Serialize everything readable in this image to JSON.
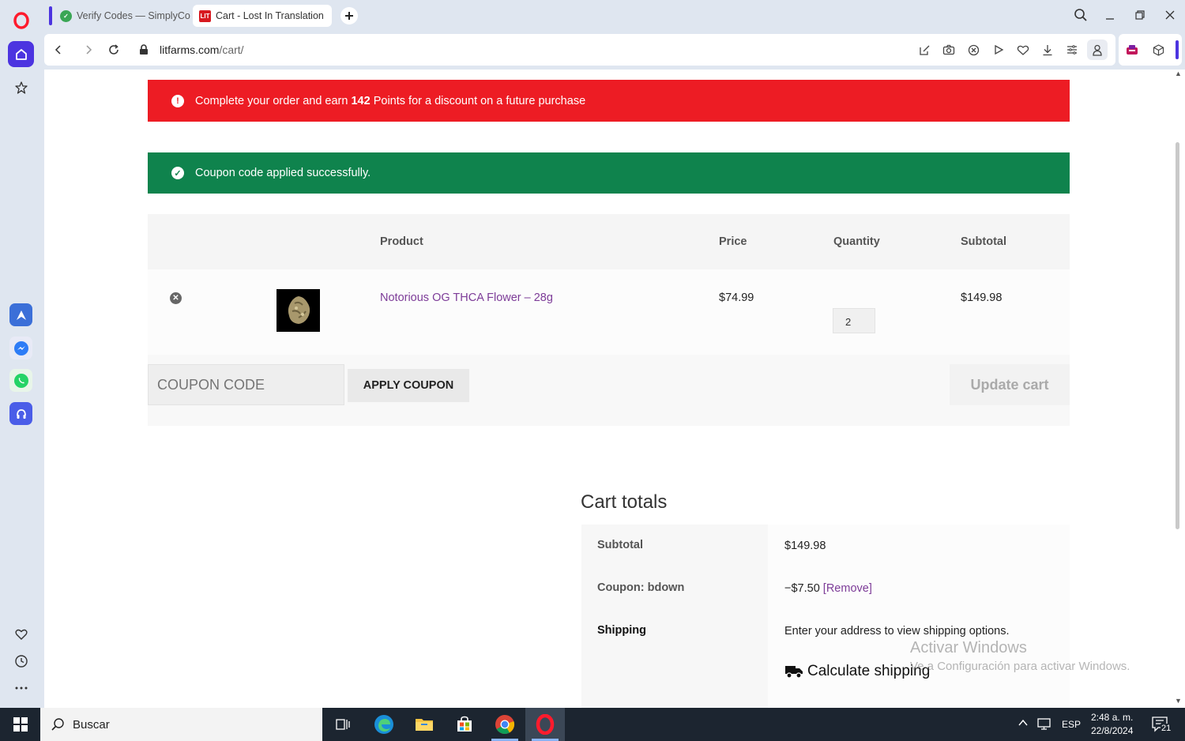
{
  "browser": {
    "tabs": [
      {
        "title": "Verify Codes — SimplyCo",
        "active": false,
        "favicon": "simplycodes-icon"
      },
      {
        "title": "Cart - Lost In Translation",
        "active": true,
        "favicon": "lit-icon",
        "favicon_text": "LIT"
      }
    ],
    "url": {
      "domain": "litfarms.com",
      "path": "/cart/"
    }
  },
  "page": {
    "points_notice": {
      "prefix": "Complete your order and earn ",
      "points": "142",
      "suffix": " Points for a discount on a future purchase",
      "color": "#ed1c24"
    },
    "coupon_notice": {
      "text": "Coupon code applied successfully.",
      "color": "#0f834d"
    },
    "cart_table": {
      "headers": {
        "product": "Product",
        "price": "Price",
        "quantity": "Quantity",
        "subtotal": "Subtotal"
      },
      "items": [
        {
          "name": "Notorious OG THCA Flower – 28g",
          "price": "$74.99",
          "quantity": "2",
          "subtotal": "$149.98"
        }
      ]
    },
    "coupon": {
      "placeholder": "COUPON CODE",
      "apply_label": "APPLY COUPON",
      "update_label": "Update cart"
    },
    "cart_totals": {
      "title": "Cart totals",
      "subtotal_label": "Subtotal",
      "subtotal_value": "$149.98",
      "coupon_label": "Coupon: bdown",
      "coupon_value": "−$7.50",
      "coupon_remove": "[Remove]",
      "shipping_label": "Shipping",
      "shipping_text": "Enter your address to view shipping options.",
      "calculate_label": "Calculate shipping"
    },
    "link_color": "#7d3c98"
  },
  "os": {
    "watermark_title": "Activar Windows",
    "watermark_sub": "Ve a Configuración para activar Windows.",
    "search_placeholder": "Buscar",
    "language": "ESP",
    "time": "2:48 a. m.",
    "date": "22/8/2024",
    "notification_count": "21"
  }
}
